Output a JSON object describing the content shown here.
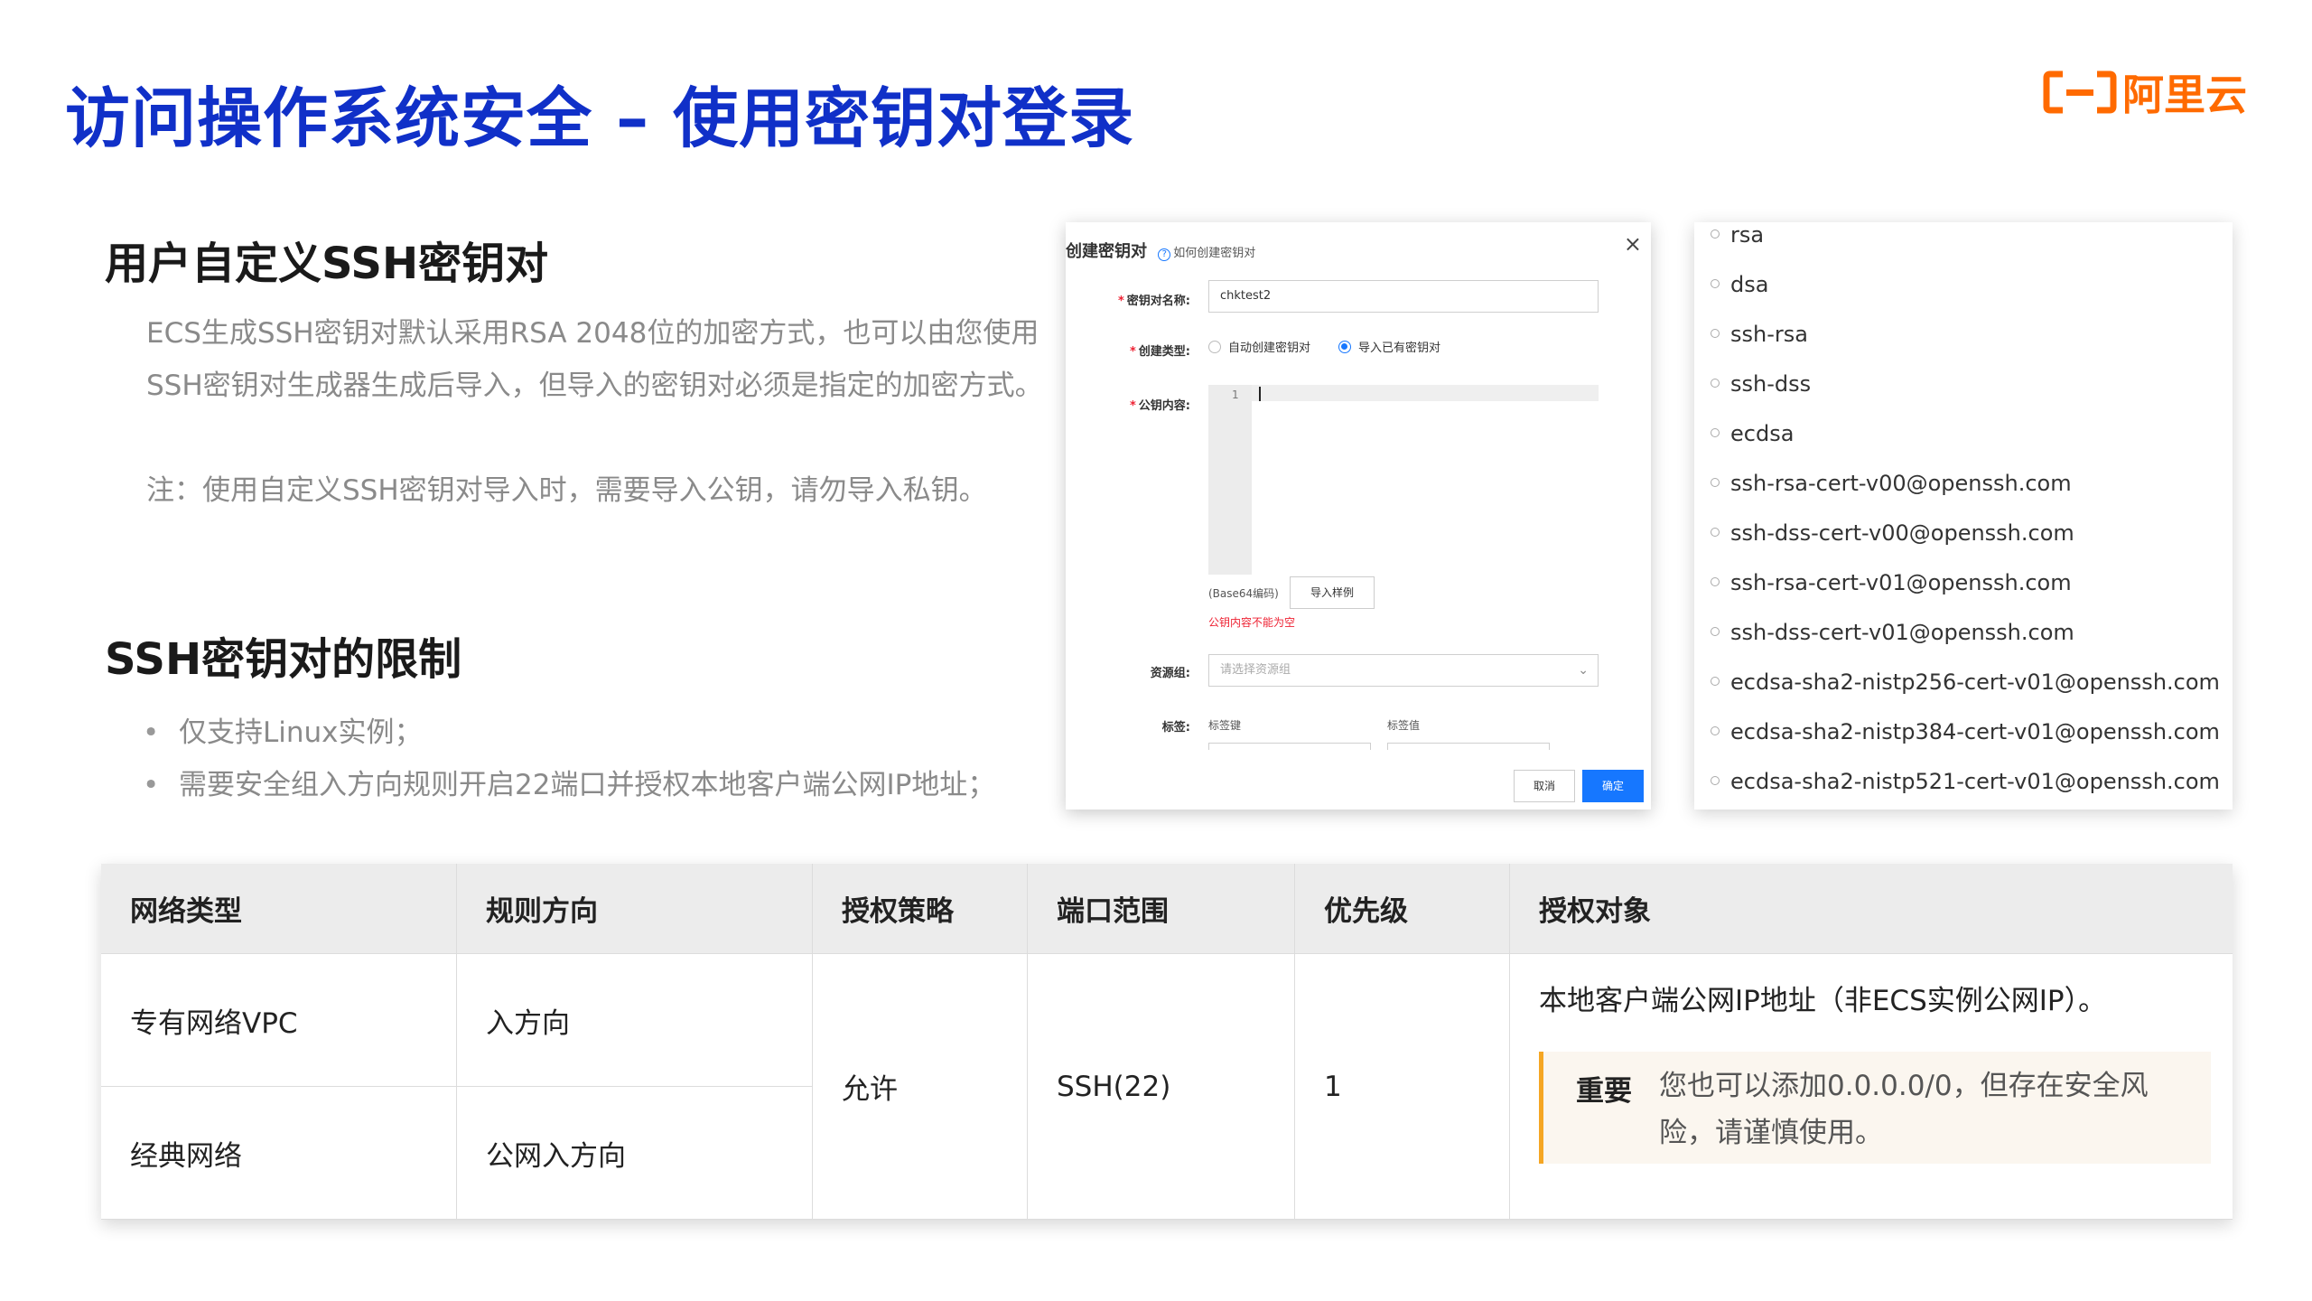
{
  "page": {
    "title": "访问操作系统安全 – 使用密钥对登录",
    "logo_text": "阿里云"
  },
  "section1": {
    "title": "用户自定义SSH密钥对",
    "line1": "ECS生成SSH密钥对默认采用RSA 2048位的加密方式，也可以由您使用",
    "line2": "SSH密钥对生成器生成后导入，但导入的密钥对必须是指定的加密方式。",
    "note": "注：使用自定义SSH密钥对导入时，需要导入公钥，请勿导入私钥。"
  },
  "section2": {
    "title": "SSH密钥对的限制",
    "bullets": [
      "仅支持Linux实例；",
      " 需要安全组入方向规则开启22端口并授权本地客户端公网IP地址；"
    ]
  },
  "dialog": {
    "title": "创建密钥对",
    "help_link": "如何创建密钥对",
    "name_label": "密钥对名称:",
    "name_value": "chktest2",
    "type_label": "创建类型:",
    "type_auto": "自动创建密钥对",
    "type_import": "导入已有密钥对",
    "selected_type": "导入已有密钥对",
    "pubkey_label": "公钥内容:",
    "line_number": "1",
    "base64_hint": "(Base64编码)",
    "sample_button": "导入样例",
    "error_text": "公钥内容不能为空",
    "rg_label": "资源组:",
    "rg_placeholder": "请选择资源组",
    "tag_label": "标签:",
    "tag_key": "标签键",
    "tag_value": "标签值",
    "cancel_button": "取消",
    "ok_button": "确定"
  },
  "algorithms": [
    "rsa",
    "dsa",
    "ssh-rsa",
    "ssh-dss",
    "ecdsa",
    "ssh-rsa-cert-v00@openssh.com",
    "ssh-dss-cert-v00@openssh.com",
    "ssh-rsa-cert-v01@openssh.com",
    "ssh-dss-cert-v01@openssh.com",
    "ecdsa-sha2-nistp256-cert-v01@openssh.com",
    "ecdsa-sha2-nistp384-cert-v01@openssh.com",
    "ecdsa-sha2-nistp521-cert-v01@openssh.com"
  ],
  "table": {
    "headers": [
      "网络类型",
      "规则方向",
      "授权策略",
      "端口范围",
      "优先级",
      "授权对象"
    ],
    "rows": [
      [
        "专有网络VPC",
        "入方向"
      ],
      [
        "经典网络",
        "公网入方向"
      ]
    ],
    "policy": "允许",
    "port": "SSH(22)",
    "priority": "1",
    "target": "本地客户端公网IP地址（非ECS实例公网IP）。",
    "note_label": "重要",
    "note_text": "您也可以添加0.0.0.0/0，但存在安全风险，请谨慎使用。"
  },
  "colors": {
    "title_blue": "#1030c8",
    "brand_orange": "#ff6a00",
    "primary_button": "#1677ff",
    "error_red": "#e22233",
    "note_border": "#f5a623"
  }
}
